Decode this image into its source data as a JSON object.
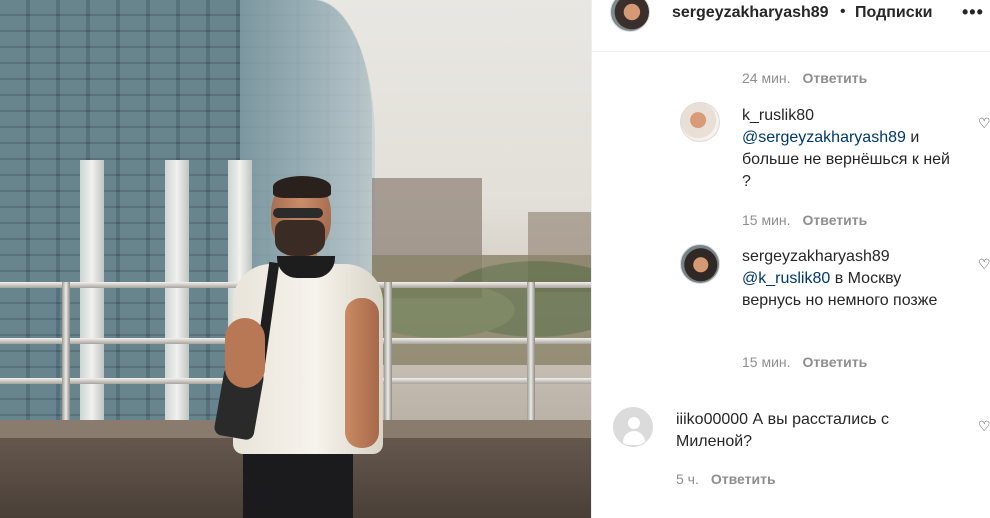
{
  "post": {
    "author": "sergeyzakharyash89",
    "separator": "•",
    "follow_label": "Подписки",
    "more_icon": "more-horizontal-icon",
    "more_glyph": "•••"
  },
  "comments": [
    {
      "time": "24 мин.",
      "reply_label": "Ответить"
    },
    {
      "user": "k_ruslik80",
      "mention": "@sergeyzakharyash89",
      "text": " и больше не вернёшься к ней ?",
      "time": "15 мин.",
      "reply_label": "Ответить"
    },
    {
      "user": "sergeyzakharyash89",
      "mention": "@k_ruslik80",
      "text": " в Москву вернусь но немного позже",
      "time": "15 мин.",
      "reply_label": "Ответить"
    },
    {
      "user": "iiiko00000",
      "text": "А вы расстались с Миленой?",
      "time": "5 ч.",
      "reply_label": "Ответить"
    }
  ],
  "icons": {
    "like": "heart-outline-icon",
    "heart_glyph": "♡"
  },
  "colors": {
    "mention": "#00376b",
    "meta": "#8e8e8e",
    "text": "#262626"
  }
}
